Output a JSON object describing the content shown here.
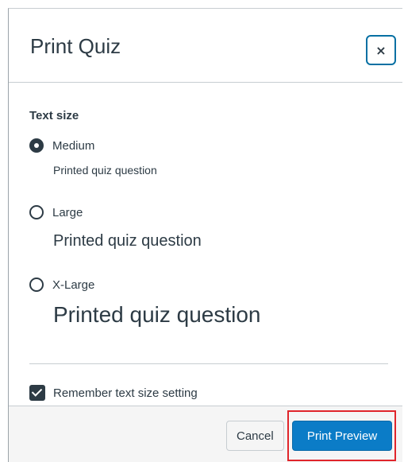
{
  "modal": {
    "title": "Print Quiz",
    "close_label": "×"
  },
  "text_size": {
    "label": "Text size",
    "options": [
      {
        "label": "Medium",
        "sample": "Printed quiz question",
        "selected": true
      },
      {
        "label": "Large",
        "sample": "Printed quiz question",
        "selected": false
      },
      {
        "label": "X-Large",
        "sample": "Printed quiz question",
        "selected": false
      }
    ]
  },
  "remember": {
    "label": "Remember text size setting",
    "checked": true
  },
  "footer": {
    "cancel_label": "Cancel",
    "print_preview_label": "Print Preview"
  },
  "colors": {
    "text": "#2d3b45",
    "primary": "#0b7cc7",
    "highlight": "#e0252b"
  }
}
